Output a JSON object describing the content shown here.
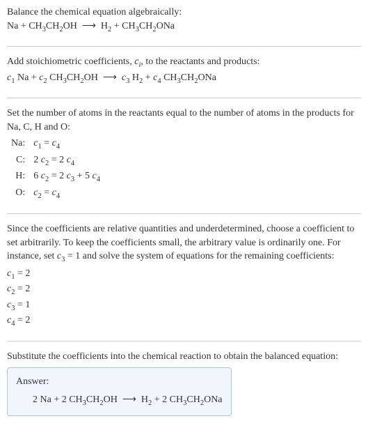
{
  "section1": {
    "title": "Balance the chemical equation algebraically:",
    "equation": "Na + CH₃CH₂OH ⟶ H₂ + CH₃CH₂ONa"
  },
  "section2": {
    "title_pre": "Add stoichiometric coefficients, ",
    "title_var": "cᵢ",
    "title_post": ", to the reactants and products:",
    "equation": "c₁ Na + c₂ CH₃CH₂OH ⟶ c₃ H₂ + c₄ CH₃CH₂ONa"
  },
  "section3": {
    "title": "Set the number of atoms in the reactants equal to the number of atoms in the products for Na, C, H and O:",
    "rows": [
      {
        "label": "Na:",
        "eq": "c₁ = c₄"
      },
      {
        "label": "C:",
        "eq": "2 c₂ = 2 c₄"
      },
      {
        "label": "H:",
        "eq": "6 c₂ = 2 c₃ + 5 c₄"
      },
      {
        "label": "O:",
        "eq": "c₂ = c₄"
      }
    ]
  },
  "section4": {
    "title_pre": "Since the coefficients are relative quantities and underdetermined, choose a coefficient to set arbitrarily. To keep the coefficients small, the arbitrary value is ordinarily one. For instance, set ",
    "title_var": "c₃ = 1",
    "title_post": " and solve the system of equations for the remaining coefficients:",
    "coeffs": [
      "c₁ = 2",
      "c₂ = 2",
      "c₃ = 1",
      "c₄ = 2"
    ]
  },
  "section5": {
    "title": "Substitute the coefficients into the chemical reaction to obtain the balanced equation:"
  },
  "answer": {
    "label": "Answer:",
    "equation": "2 Na + 2 CH₃CH₂OH ⟶ H₂ + 2 CH₃CH₂ONa"
  },
  "chart_data": {
    "type": "table",
    "title": "Chemical equation balancing",
    "unbalanced_equation": "Na + CH3CH2OH -> H2 + CH3CH2ONa",
    "balanced_equation": "2 Na + 2 CH3CH2OH -> H2 + 2 CH3CH2ONa",
    "element_balance": [
      {
        "element": "Na",
        "equation": "c1 = c4"
      },
      {
        "element": "C",
        "equation": "2 c2 = 2 c4"
      },
      {
        "element": "H",
        "equation": "6 c2 = 2 c3 + 5 c4"
      },
      {
        "element": "O",
        "equation": "c2 = c4"
      }
    ],
    "solved_coefficients": {
      "c1": 2,
      "c2": 2,
      "c3": 1,
      "c4": 2
    }
  }
}
